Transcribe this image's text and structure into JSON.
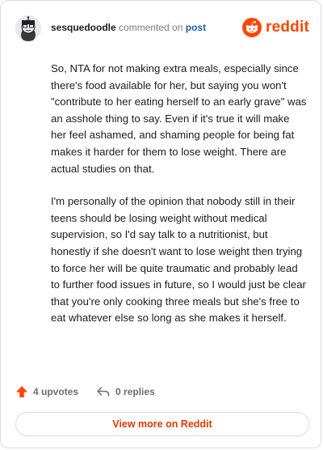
{
  "header": {
    "username": "sesquedoodle",
    "action_text": "commented on",
    "target_text": "post",
    "brand": "reddit"
  },
  "comment": {
    "paragraphs": [
      "So, NTA for not making extra meals, especially since there's food available for her, but saying you won't \"contribute to her eating herself to an early grave\" was an asshole thing to say. Even if it's true it will make her feel ashamed, and shaming people for being fat makes it harder for them to lose weight. There are actual studies on that.",
      "I'm personally of the opinion that nobody still in their teens should be losing weight without medical supervision, so I'd say talk to a nutritionist, but honestly if she doesn't want to lose weight then trying to force her will be quite traumatic and probably lead to further food issues in future, so I would just be clear that you're only cooking three meals but she's free to eat whatever else so long as she makes it herself."
    ]
  },
  "actions": {
    "upvotes": "4 upvotes",
    "replies": "0 replies"
  },
  "footer": {
    "view_more": "View more on Reddit"
  },
  "colors": {
    "brand": "#ff4500",
    "link": "#1f5fa8",
    "view_more": "#d93a00",
    "upvote": "#ff4500"
  },
  "icons": {
    "avatar": "snoo-avatar",
    "brand": "reddit-logo-icon",
    "upvote": "upvote-arrow-icon",
    "reply": "reply-arrow-icon"
  }
}
